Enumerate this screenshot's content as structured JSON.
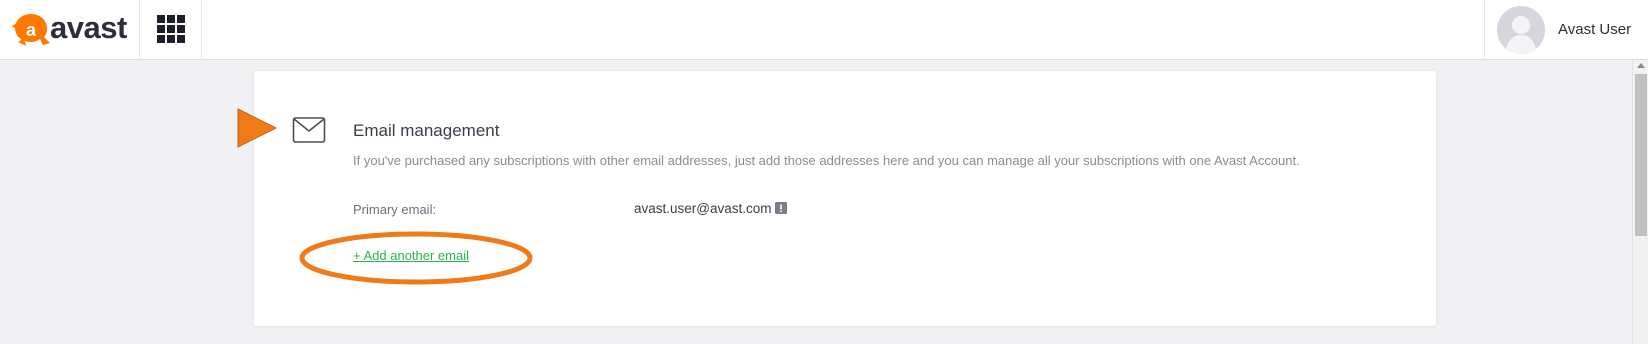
{
  "header": {
    "brand": {
      "name": "avast",
      "mark_letter": "a",
      "icon": "avast-logo-icon"
    },
    "apps_icon": "apps-grid-icon",
    "user": {
      "name": "Avast User",
      "avatar_icon": "user-avatar-icon"
    }
  },
  "email_management": {
    "icon": "envelope-icon",
    "title": "Email management",
    "description": "If you've purchased any subscriptions with other email addresses, just add those addresses here and you can manage all your subscriptions with one Avast Account.",
    "primary_email_label": "Primary email:",
    "primary_email_value": "avast.user@avast.com",
    "primary_badge_icon": "flag-icon",
    "add_email_link": "+ Add another email"
  },
  "colors": {
    "brand_orange": "#ff7800",
    "link_green": "#2bb34a",
    "annotation_orange": "#f07a1a",
    "page_background": "#f1f1f4"
  }
}
